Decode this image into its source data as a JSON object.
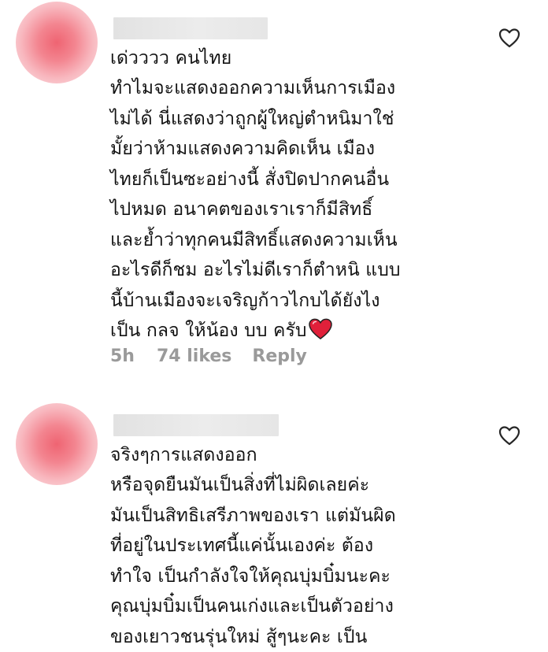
{
  "comments": [
    {
      "text": "เด่วววว คนไทย\nทำไมจะแสดงออกความเห็นการเมือง\nไม่ได้ นี่แสดงว่าถูกผู้ใหญ่ตำหนิมาใช่\nมั้ยว่าห้ามแสดงความคิดเห็น เมือง\nไทยก็เป็นซะอย่างนี้ สั่งปิดปากคนอื่น\nไปหมด อนาคตของเราเราก็มีสิทธิ์\nและย้ำว่าทุกคนมีสิทธิ์แสดงความเห็น\nอะไรดีก็ชม อะไรไม่ดีเราก็ตำหนิ แบบ\nนี้บ้านเมืองจะเจริญก้าวไกบได้ยังไง\nเป็น กลจ ให้น้อง บบ ครับ",
      "emoji": "red-heart",
      "time": "5h",
      "likes": "74 likes",
      "reply": "Reply",
      "liked": false
    },
    {
      "text": "จริงๆการแสดงออก\nหรือจุดยืนมันเป็นสิ่งที่ไม่ผิดเลยค่ะ\nมันเป็นสิทธิเสรีภาพของเรา แต่มันผิด\nที่อยู่ในประเทศนี้แค่นั้นเองค่ะ ต้อง\nทำใจ เป็นกำลังใจให้คุณบุ่มบิ๋มนะคะ\nคุณบุ่มบิ๋มเป็นคนเก่งและเป็นตัวอย่าง\nของเยาวชนรุ่นใหม่ สู้ๆนะคะ เป็น",
      "liked": false
    }
  ],
  "colors": {
    "text": "#131313",
    "meta": "#9a9a9a",
    "heart": "#e0203a",
    "avatar": "#ef6472",
    "redaction": "#e6e6e6"
  }
}
